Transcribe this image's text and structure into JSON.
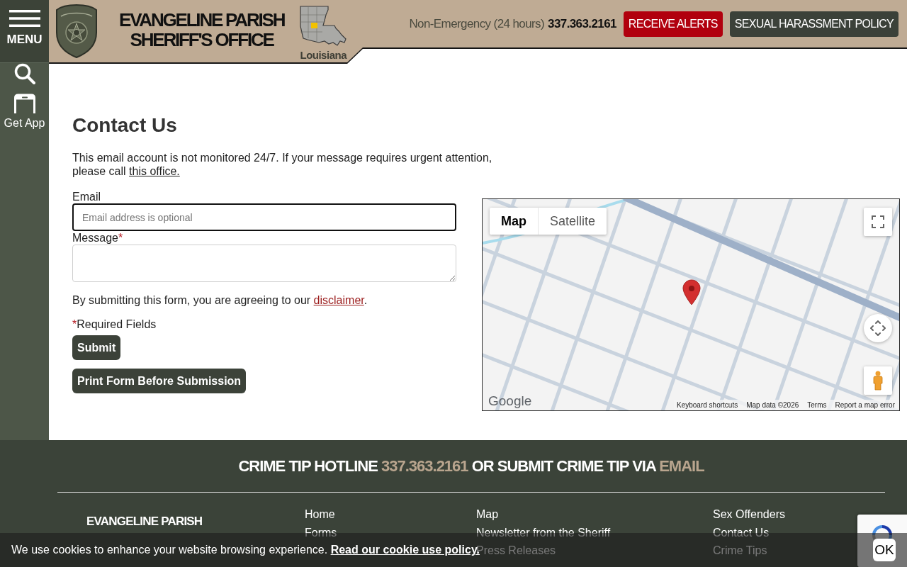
{
  "sidebar": {
    "menu_label": "MENU",
    "items": [
      {
        "kind": "search"
      },
      {
        "kind": "app",
        "label": "Get App"
      }
    ]
  },
  "header": {
    "title_lines": [
      "EVANGELINE PARISH",
      "SHERIFF'S OFFICE"
    ],
    "state_label": "Louisiana",
    "phone_label": "Non-Emergency (24 hours)",
    "phone": "337.363.2161",
    "buttons": [
      {
        "kind": "alert",
        "label": "RECEIVE ALERTS"
      },
      {
        "kind": "policy",
        "label": "SEXUAL HARASSMENT POLICY"
      }
    ]
  },
  "contact": {
    "title": "Contact Us",
    "notice": "This email account is not monitored 24/7. If your message requires urgent attention, please call",
    "notice_link": "this office.",
    "fields": [
      {
        "kind": "input",
        "label": "Email",
        "placeholder": "Email address is optional",
        "focused": true
      },
      {
        "kind": "textarea",
        "label": "Message",
        "required_mark": "*",
        "focused": false
      }
    ],
    "consent": "By submitting this form, you are agreeing to our",
    "consent_link": "disclaimer",
    "consent_end": ".",
    "required_note": {
      "mark": "*",
      "text": "Required Fields"
    },
    "buttons": [
      "Submit",
      "Print Form Before Submission"
    ]
  },
  "map": {
    "type_buttons": [
      {
        "label": "Map",
        "selected": true
      },
      {
        "label": "Satellite",
        "selected": false
      }
    ],
    "logo": "Google",
    "attribution": [
      "Keyboard shortcuts",
      "Map data ©2026",
      "Terms",
      "Report a map error"
    ]
  },
  "footer": {
    "hotline": {
      "lead": "CRIME TIP HOTLINE",
      "phone": "337.363.2161",
      "middle": "OR SUBMIT CRIME TIP VIA",
      "email": "EMAIL"
    },
    "brand": [
      "EVANGELINE PARISH"
    ],
    "link_columns": [
      [
        "Home",
        "Forms"
      ],
      [
        "Map",
        "Newsletter from the Sheriff",
        "Press Releases"
      ],
      [
        "Sex Offenders",
        "Contact Us",
        "Crime Tips"
      ]
    ]
  },
  "cookie_bar": {
    "text": "We use cookies to enhance your website browsing experience.",
    "link": "Read our cookie use policy.",
    "button": "OK"
  }
}
